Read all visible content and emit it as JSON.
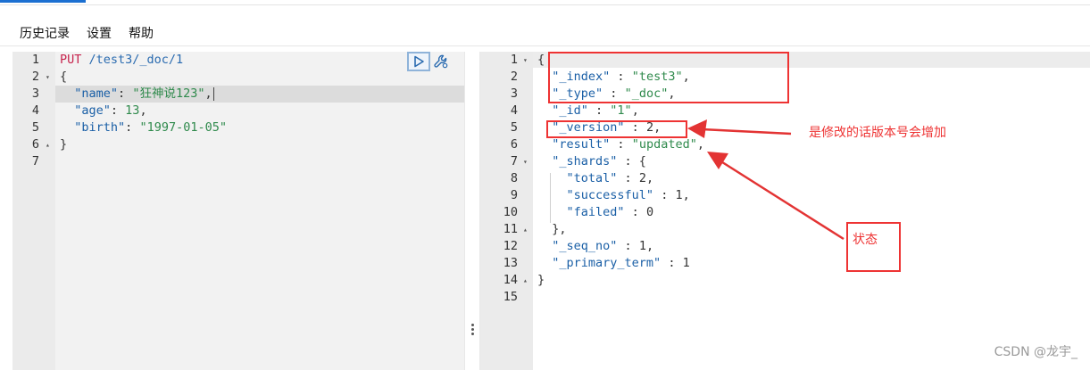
{
  "menu": [
    "历史记录",
    "设置",
    "帮助"
  ],
  "request_lines": [
    {
      "num": "1",
      "fold": "",
      "segs": [
        [
          "k-method",
          "PUT "
        ],
        [
          "k-url",
          "/test3/_doc/1"
        ]
      ]
    },
    {
      "num": "2",
      "fold": "▾",
      "segs": [
        [
          "k-punc",
          "{"
        ]
      ]
    },
    {
      "num": "3",
      "fold": "",
      "segs": [
        [
          "k-punc",
          "  "
        ],
        [
          "k-key",
          "\"name\""
        ],
        [
          "k-punc",
          ": "
        ],
        [
          "k-str",
          "\"狂神说123\""
        ],
        [
          "k-punc",
          ","
        ]
      ]
    },
    {
      "num": "4",
      "fold": "",
      "segs": [
        [
          "k-punc",
          "  "
        ],
        [
          "k-key",
          "\"age\""
        ],
        [
          "k-punc",
          ": "
        ],
        [
          "k-num",
          "13"
        ],
        [
          "k-punc",
          ","
        ]
      ]
    },
    {
      "num": "5",
      "fold": "",
      "segs": [
        [
          "k-punc",
          "  "
        ],
        [
          "k-key",
          "\"birth\""
        ],
        [
          "k-punc",
          ": "
        ],
        [
          "k-str",
          "\"1997-01-05\""
        ]
      ]
    },
    {
      "num": "6",
      "fold": "▴",
      "segs": [
        [
          "k-punc",
          "}"
        ]
      ]
    },
    {
      "num": "7",
      "fold": "",
      "segs": []
    }
  ],
  "response_lines": [
    {
      "num": "1",
      "fold": "▾",
      "segs": [
        [
          "k-punc",
          "{"
        ]
      ]
    },
    {
      "num": "2",
      "fold": "",
      "segs": [
        [
          "k-punc",
          "  "
        ],
        [
          "k-rkey",
          "\"_index\""
        ],
        [
          "k-punc",
          " : "
        ],
        [
          "k-rstr",
          "\"test3\""
        ],
        [
          "k-punc",
          ","
        ]
      ]
    },
    {
      "num": "3",
      "fold": "",
      "segs": [
        [
          "k-punc",
          "  "
        ],
        [
          "k-rkey",
          "\"_type\""
        ],
        [
          "k-punc",
          " : "
        ],
        [
          "k-rstr",
          "\"_doc\""
        ],
        [
          "k-punc",
          ","
        ]
      ]
    },
    {
      "num": "4",
      "fold": "",
      "segs": [
        [
          "k-punc",
          "  "
        ],
        [
          "k-rkey",
          "\"_id\""
        ],
        [
          "k-punc",
          " : "
        ],
        [
          "k-rstr",
          "\"1\""
        ],
        [
          "k-punc",
          ","
        ]
      ]
    },
    {
      "num": "5",
      "fold": "",
      "segs": [
        [
          "k-punc",
          "  "
        ],
        [
          "k-rkey",
          "\"_version\""
        ],
        [
          "k-punc",
          " : "
        ],
        [
          "k-rnum",
          "2"
        ],
        [
          "k-punc",
          ","
        ]
      ]
    },
    {
      "num": "6",
      "fold": "",
      "segs": [
        [
          "k-punc",
          "  "
        ],
        [
          "k-rkey",
          "\"result\""
        ],
        [
          "k-punc",
          " : "
        ],
        [
          "k-rstr",
          "\"updated\""
        ],
        [
          "k-punc",
          ","
        ]
      ]
    },
    {
      "num": "7",
      "fold": "▾",
      "segs": [
        [
          "k-punc",
          "  "
        ],
        [
          "k-rkey",
          "\"_shards\""
        ],
        [
          "k-punc",
          " : {"
        ]
      ]
    },
    {
      "num": "8",
      "fold": "",
      "segs": [
        [
          "k-punc",
          "    "
        ],
        [
          "k-rkey",
          "\"total\""
        ],
        [
          "k-punc",
          " : "
        ],
        [
          "k-rnum",
          "2"
        ],
        [
          "k-punc",
          ","
        ]
      ]
    },
    {
      "num": "9",
      "fold": "",
      "segs": [
        [
          "k-punc",
          "    "
        ],
        [
          "k-rkey",
          "\"successful\""
        ],
        [
          "k-punc",
          " : "
        ],
        [
          "k-rnum",
          "1"
        ],
        [
          "k-punc",
          ","
        ]
      ]
    },
    {
      "num": "10",
      "fold": "",
      "segs": [
        [
          "k-punc",
          "    "
        ],
        [
          "k-rkey",
          "\"failed\""
        ],
        [
          "k-punc",
          " : "
        ],
        [
          "k-rnum",
          "0"
        ]
      ]
    },
    {
      "num": "11",
      "fold": "▴",
      "segs": [
        [
          "k-punc",
          "  },"
        ]
      ]
    },
    {
      "num": "12",
      "fold": "",
      "segs": [
        [
          "k-punc",
          "  "
        ],
        [
          "k-rkey",
          "\"_seq_no\""
        ],
        [
          "k-punc",
          " : "
        ],
        [
          "k-rnum",
          "1"
        ],
        [
          "k-punc",
          ","
        ]
      ]
    },
    {
      "num": "13",
      "fold": "",
      "segs": [
        [
          "k-punc",
          "  "
        ],
        [
          "k-rkey",
          "\"_primary_term\""
        ],
        [
          "k-punc",
          " : "
        ],
        [
          "k-rnum",
          "1"
        ]
      ]
    },
    {
      "num": "14",
      "fold": "▴",
      "segs": [
        [
          "k-punc",
          "}"
        ]
      ]
    },
    {
      "num": "15",
      "fold": "",
      "segs": []
    }
  ],
  "annotations": {
    "version_note": "是修改的话版本号会增加",
    "status_note": "状态",
    "color": "#e33333"
  },
  "icons": {
    "run": "play-icon",
    "settings": "wrench-icon"
  },
  "watermark": "CSDN @龙宇_"
}
